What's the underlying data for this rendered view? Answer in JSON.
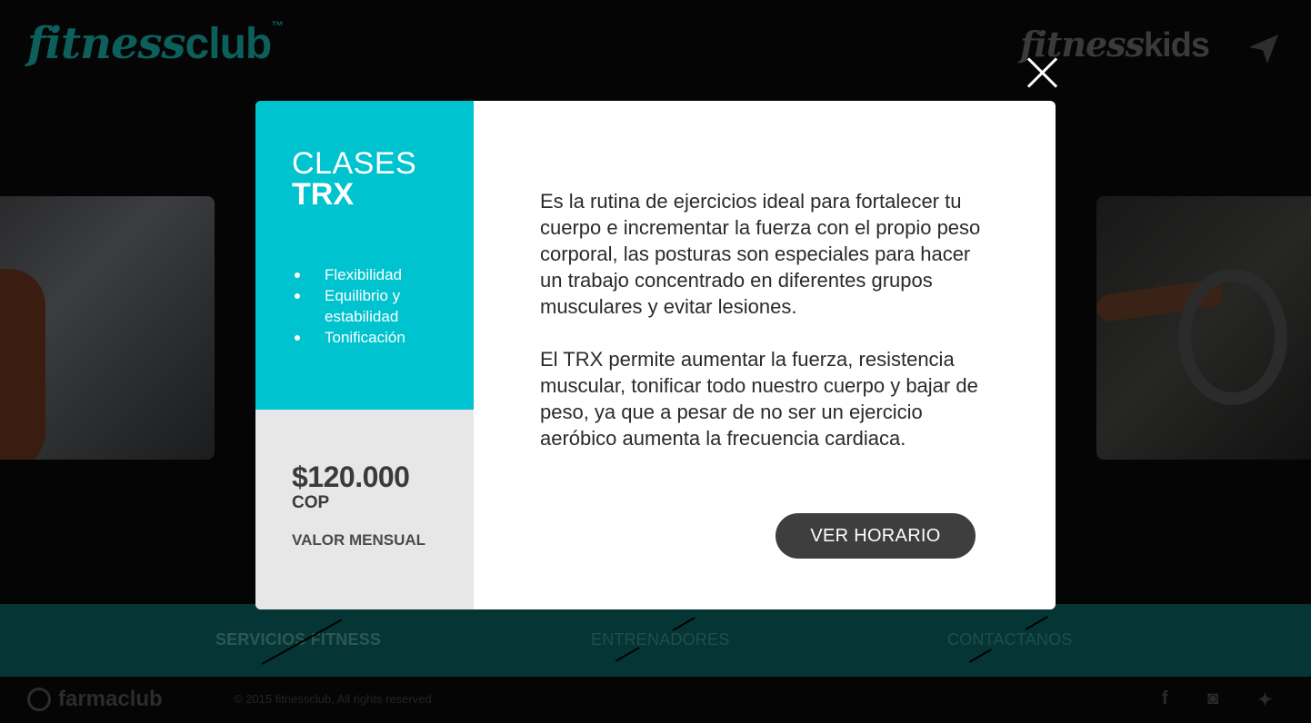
{
  "header": {
    "logo_script": "fitness",
    "logo_word": "club",
    "logo_tm": "™",
    "kids_script": "fitness",
    "kids_word": "kids",
    "nav_icon": "paper-plane-icon"
  },
  "modal": {
    "class_label": "CLASES",
    "class_name": "TRX",
    "benefits": [
      "Flexibilidad",
      "Equilibrio y estabilidad",
      "Tonificación"
    ],
    "price": "$120.000",
    "currency": "COP",
    "price_period": "VALOR MENSUAL",
    "description": [
      "Es la rutina de ejercicios ideal para fortalecer tu cuerpo e incrementar la fuerza con el propio peso corporal, las posturas son especiales para hacer un trabajo concentrado en diferentes grupos musculares y evitar lesiones.",
      "El TRX permite aumentar la fuerza, resistencia muscular, tonificar todo nuestro cuerpo y bajar de peso, ya que a pesar de no ser un ejercicio aeróbico aumenta la frecuencia cardiaca."
    ],
    "cta_label": "VER HORARIO",
    "close_icon": "close-icon",
    "colors": {
      "accent": "#00c3d0",
      "price_panel": "#e7e7e8",
      "cta": "#3e3e3e"
    }
  },
  "bottom_nav": {
    "items": [
      {
        "label": "SERVICIOS FITNESS",
        "active": true
      },
      {
        "label": "ENTRENADORES",
        "active": false
      },
      {
        "label": "CONTACTANOS",
        "active": false
      }
    ]
  },
  "footer": {
    "brand": "farmaclub",
    "copyright": "© 2015 fitnessclub, All rights reserved",
    "social": [
      {
        "icon": "facebook-icon",
        "glyph": "f"
      },
      {
        "icon": "instagram-icon",
        "glyph": "◙"
      },
      {
        "icon": "twitter-icon",
        "glyph": "✦"
      }
    ]
  }
}
